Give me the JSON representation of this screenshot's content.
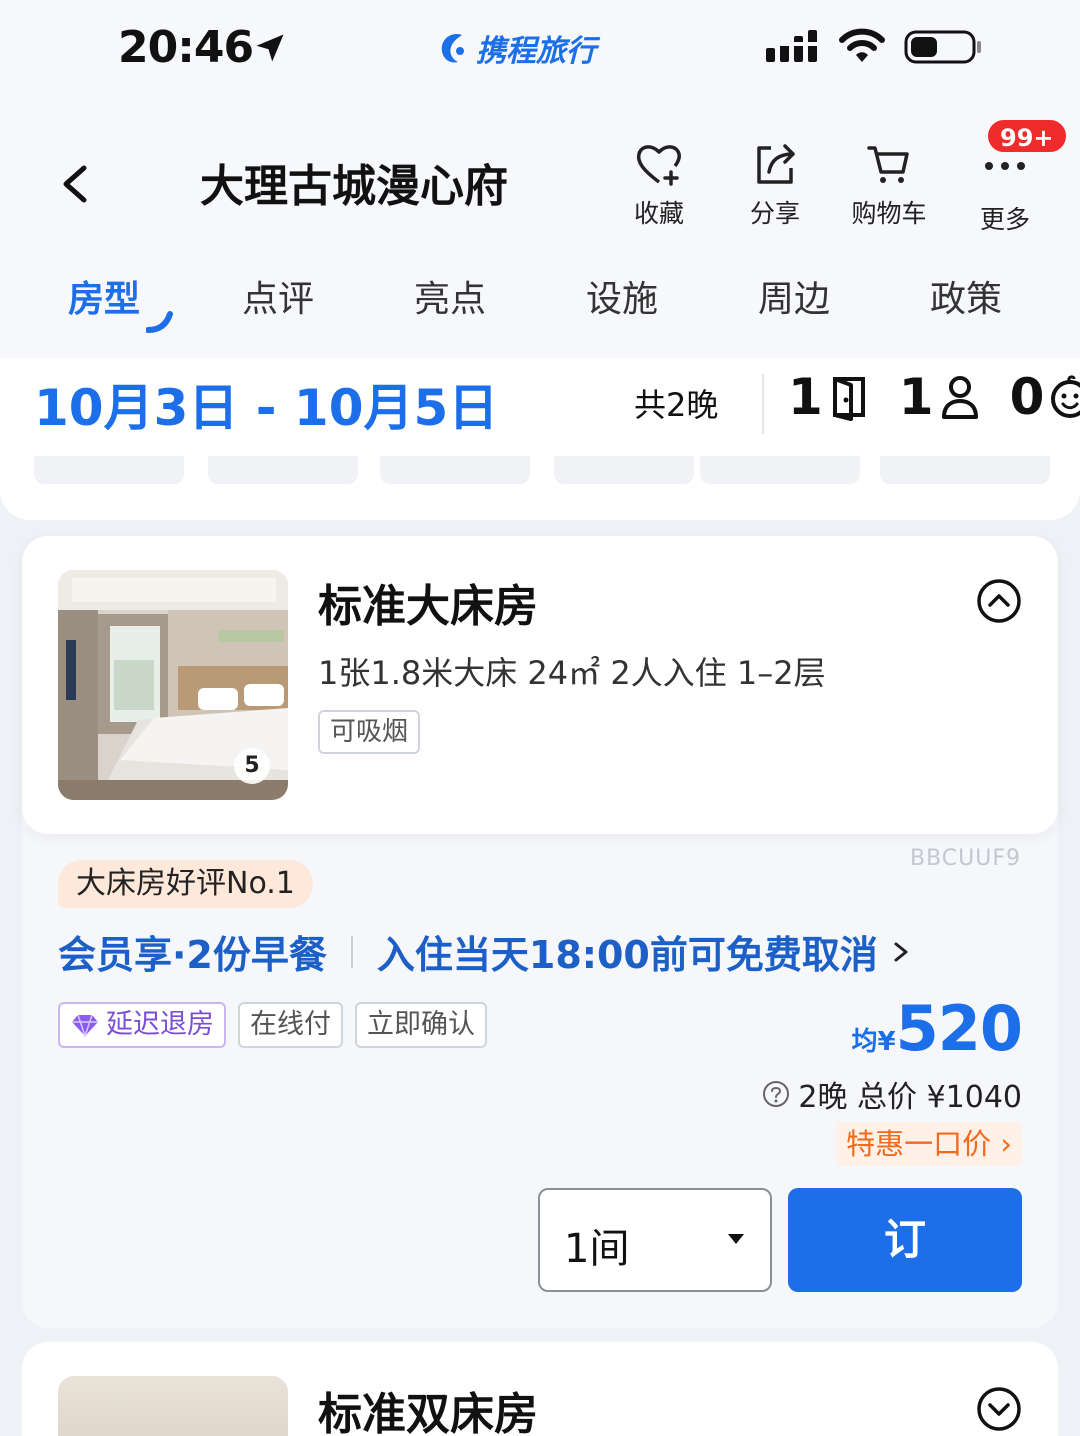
{
  "status_bar": {
    "time": "20:46",
    "brand": "携程旅行",
    "icons": [
      "location-arrow-icon",
      "signal-icon",
      "wifi-icon",
      "battery-icon"
    ]
  },
  "header": {
    "title": "大理古城漫心府",
    "actions": [
      {
        "label": "收藏",
        "icon": "heart-plus-icon"
      },
      {
        "label": "分享",
        "icon": "share-icon"
      },
      {
        "label": "购物车",
        "icon": "cart-icon"
      },
      {
        "label": "更多",
        "icon": "more-dots-icon"
      }
    ],
    "badge": "99+"
  },
  "tabs": [
    {
      "label": "房型",
      "active": true
    },
    {
      "label": "点评",
      "active": false
    },
    {
      "label": "亮点",
      "active": false
    },
    {
      "label": "设施",
      "active": false
    },
    {
      "label": "周边",
      "active": false
    },
    {
      "label": "政策",
      "active": false
    }
  ],
  "booking": {
    "dates": "10月3日 - 10月5日",
    "nights": "共2晚",
    "rooms": "1",
    "adults": "1",
    "children": "0"
  },
  "room": {
    "name": "标准大床房",
    "spec": "1张1.8米大床  24㎡  2人入住  1–2层",
    "smoke_tag": "可吸烟",
    "image_count": "5",
    "rate_code": "BBCUUF9",
    "best_badge": "大床房好评No.1",
    "benefit_meal": "会员享·2份早餐",
    "benefit_cancel": "入住当天18:00前可免费取消",
    "tags": [
      "延迟退房",
      "在线付",
      "立即确认"
    ],
    "price_prefix": "均",
    "currency": "¥",
    "price": "520",
    "total": "2晚 总价 ¥1040",
    "deal": "特惠一口价",
    "qty": "1间",
    "book_label": "订"
  },
  "room2": {
    "name": "标准双床房"
  },
  "colors": {
    "accent": "#1c6fe8",
    "badge_red": "#f02b2b",
    "deal_orange": "#f26a1b"
  }
}
